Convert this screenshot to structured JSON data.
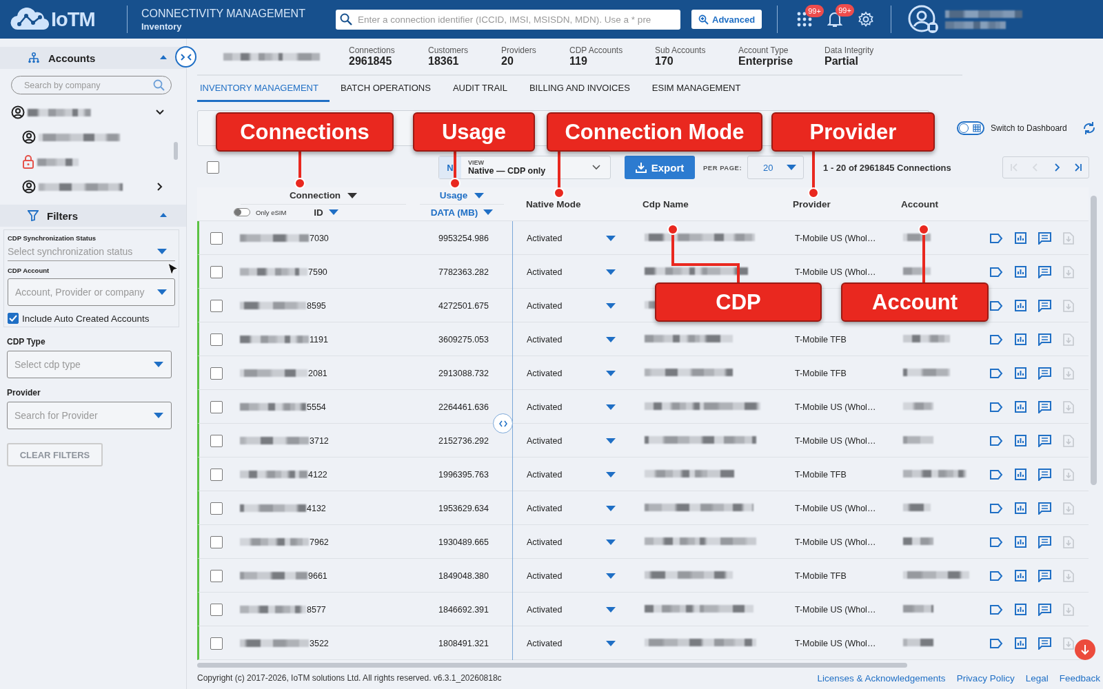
{
  "header": {
    "logo_text": "IoTM",
    "title": "CONNECTIVITY MANAGEMENT",
    "subtitle": "Inventory",
    "search": {
      "placeholder": "Enter a connection identifier (ICCID, IMSI, MSISDN, MDN). Use a * pre"
    },
    "advanced_button": "Advanced",
    "badges": [
      {
        "kind": "apps",
        "count": "99+"
      },
      {
        "kind": "notifications",
        "count": "99+"
      }
    ]
  },
  "sidebar": {
    "accounts": {
      "title": "Accounts",
      "expanded": true,
      "search": {
        "placeholder": "Search by company"
      },
      "tree": [
        {
          "kind": "account",
          "expanded": true,
          "children": [
            {
              "kind": "account"
            },
            {
              "kind": "locked"
            },
            {
              "kind": "account",
              "expanded": false
            }
          ]
        }
      ]
    },
    "filters": {
      "title": "Filters",
      "expanded": true,
      "sync_status": {
        "label": "CDP Synchronization Status",
        "placeholder": "Select synchronization status"
      },
      "cdp_account": {
        "label": "CDP Account",
        "placeholder": "Account, Provider or company"
      },
      "include_auto": {
        "label": "Include Auto Created Accounts",
        "checked": true
      },
      "cdp_type": {
        "label": "CDP Type",
        "placeholder": "Select cdp type"
      },
      "provider": {
        "label": "Provider",
        "placeholder": "Search for Provider"
      },
      "clear_button": {
        "label": "CLEAR FILTERS",
        "disabled": true
      }
    }
  },
  "stats": [
    {
      "label": "Connections",
      "value": "2961845"
    },
    {
      "label": "Customers",
      "value": "18361"
    },
    {
      "label": "Providers",
      "value": "20"
    },
    {
      "label": "CDP Accounts",
      "value": "119"
    },
    {
      "label": "Sub Accounts",
      "value": "170"
    },
    {
      "label": "Account Type",
      "value": "Enterprise"
    },
    {
      "label": "Data Integrity",
      "value": "Partial"
    }
  ],
  "tabs": [
    {
      "label": "INVENTORY MANAGEMENT",
      "selected": true
    },
    {
      "label": "BATCH OPERATIONS",
      "selected": false
    },
    {
      "label": "AUDIT TRAIL",
      "selected": false
    },
    {
      "label": "BILLING AND INVOICES",
      "selected": false
    },
    {
      "label": "ESIM MANAGEMENT",
      "selected": false
    }
  ],
  "toolbar": {
    "dashboard_toggle": {
      "label": "Switch to Dashboard",
      "on": false
    },
    "view": {
      "badge": "N",
      "label": "VIEW",
      "value": "Native — CDP only"
    },
    "export_button": "Export",
    "per_page": {
      "label": "PER PAGE:",
      "value": "20"
    },
    "range": "1 - 20 of 2961845 Connections",
    "pager": [
      {
        "kind": "first",
        "disabled": true
      },
      {
        "kind": "prev",
        "disabled": true
      },
      {
        "kind": "next",
        "disabled": false
      },
      {
        "kind": "last",
        "disabled": false
      }
    ]
  },
  "table": {
    "select_all": {
      "checked": false
    },
    "columns": {
      "connection": "Connection",
      "only_esim": {
        "label": "Only eSIM",
        "on": false
      },
      "id": "ID",
      "usage": "Usage",
      "data": "DATA (MB)",
      "mode": "Native Mode",
      "cdp": "Cdp Name",
      "provider": "Provider",
      "account": "Account"
    },
    "rows": [
      {
        "checked": false,
        "id_end": "7030",
        "usage": "9953254.986",
        "mode": "Activated",
        "provider": "T-Mobile US (Whol…"
      },
      {
        "checked": false,
        "id_end": "7590",
        "usage": "7782363.282",
        "mode": "Activated",
        "provider": "T-Mobile US (Whol…"
      },
      {
        "checked": false,
        "id_end": "8595",
        "usage": "4272501.675",
        "mode": "Activated"
      },
      {
        "checked": false,
        "id_end": "1191",
        "usage": "3609275.053",
        "mode": "Activated",
        "provider": "T-Mobile TFB"
      },
      {
        "checked": false,
        "id_end": "2081",
        "usage": "2913088.732",
        "mode": "Activated",
        "provider": "T-Mobile TFB"
      },
      {
        "checked": false,
        "id_end": "5554",
        "usage": "2264461.636",
        "mode": "Activated",
        "provider": "T-Mobile US (Whol…"
      },
      {
        "checked": false,
        "id_end": "3712",
        "usage": "2152736.292",
        "mode": "Activated",
        "provider": "T-Mobile US (Whol…"
      },
      {
        "checked": false,
        "id_end": "4122",
        "usage": "1996395.763",
        "mode": "Activated",
        "provider": "T-Mobile TFB"
      },
      {
        "checked": false,
        "id_end": "4132",
        "usage": "1953629.634",
        "mode": "Activated",
        "provider": "T-Mobile US (Whol…"
      },
      {
        "checked": false,
        "id_end": "7962",
        "usage": "1930489.665",
        "mode": "Activated",
        "provider": "T-Mobile US (Whol…"
      },
      {
        "checked": false,
        "id_end": "9661",
        "usage": "1849048.380",
        "mode": "Activated",
        "provider": "T-Mobile TFB"
      },
      {
        "checked": false,
        "id_end": "8577",
        "usage": "1846692.391",
        "mode": "Activated",
        "provider": "T-Mobile US (Whol…"
      },
      {
        "checked": false,
        "id_end": "3522",
        "usage": "1808491.321",
        "mode": "Activated",
        "provider": "T-Mobile US (Whol…"
      }
    ]
  },
  "footer": {
    "copyright": "Copyright (c) 2017-2026, IoTM solutions Ltd. All rights reserved. v6.3.1_20260818c",
    "links": [
      "Licenses & Acknowledgements",
      "Privacy Policy",
      "Legal",
      "Feedback"
    ]
  },
  "annotations": [
    {
      "label": "Connections"
    },
    {
      "label": "Usage"
    },
    {
      "label": "Connection Mode"
    },
    {
      "label": "Provider"
    },
    {
      "label": "CDP"
    },
    {
      "label": "Account"
    }
  ]
}
